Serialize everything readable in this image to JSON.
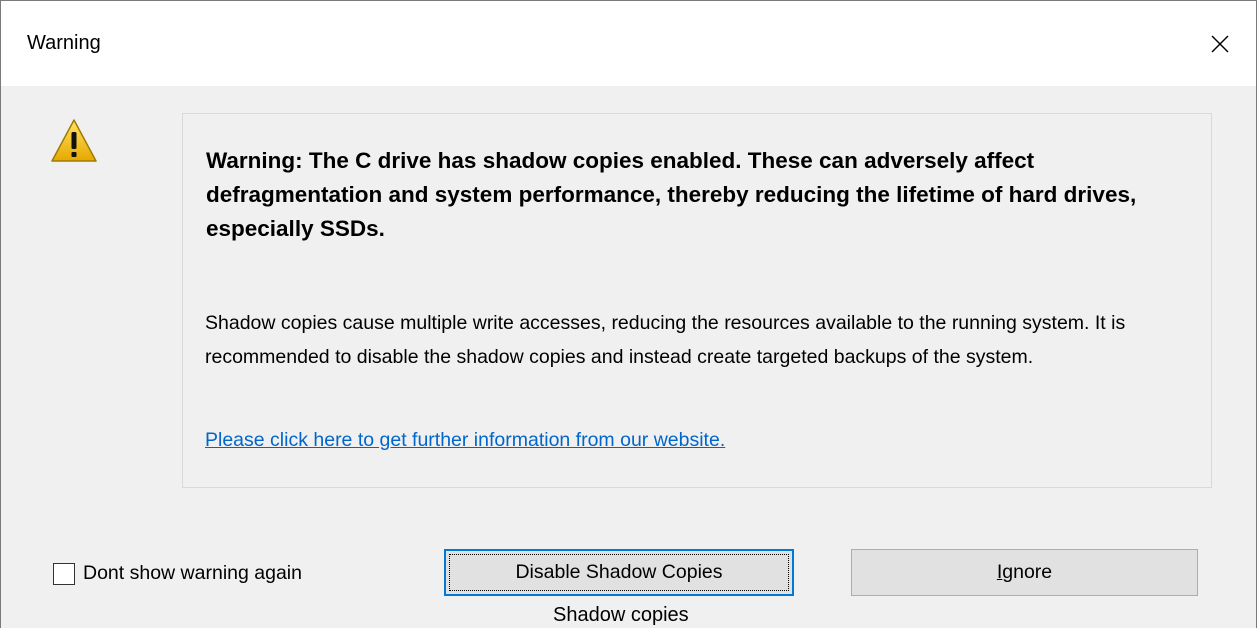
{
  "window": {
    "title": "Warning"
  },
  "message": {
    "headline": "Warning: The C drive has shadow copies enabled. These can adversely affect defragmentation and system performance, thereby reducing the lifetime of hard drives, especially SSDs.",
    "body": "Shadow copies cause multiple write accesses, reducing the resources available to the running system. It is recommended to disable the shadow copies and instead create targeted backups of the system.",
    "link": "Please click here to get further information from our website."
  },
  "footer": {
    "checkbox_label": "Dont show warning again",
    "checkbox_checked": false,
    "disable_button": "Disable Shadow Copies",
    "ignore_button": "Ignore",
    "caption": "Shadow copies"
  },
  "icons": {
    "warning": "warning-icon",
    "close": "close-icon"
  },
  "colors": {
    "link": "#0066cc",
    "focus_border": "#0078d7",
    "icon_yellow": "#f5c400"
  }
}
